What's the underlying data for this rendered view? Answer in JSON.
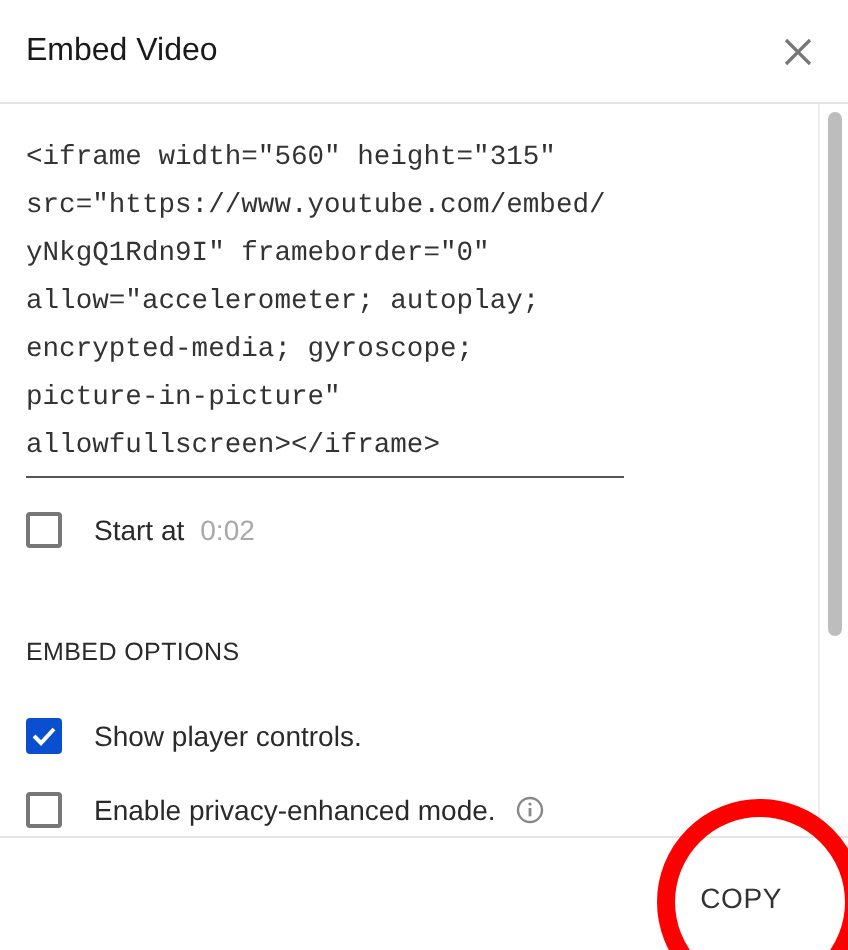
{
  "dialog": {
    "title": "Embed Video"
  },
  "embed_code": [
    "<iframe width=\"560\" height=\"315\"",
    "src=\"https://www.youtube.com/embed/",
    "yNkgQ1Rdn9I\" frameborder=\"0\"",
    "allow=\"accelerometer; autoplay;",
    "encrypted-media; gyroscope;",
    "picture-in-picture\"",
    "allowfullscreen></iframe>"
  ],
  "start_at": {
    "label": "Start at",
    "checked": false,
    "time": "0:02"
  },
  "section_heading": "EMBED OPTIONS",
  "options": [
    {
      "label": "Show player controls.",
      "checked": true,
      "info": false
    },
    {
      "label": "Enable privacy-enhanced mode.",
      "checked": false,
      "info": true
    }
  ],
  "copy_button": "COPY",
  "annotation": {
    "kind": "circle"
  }
}
